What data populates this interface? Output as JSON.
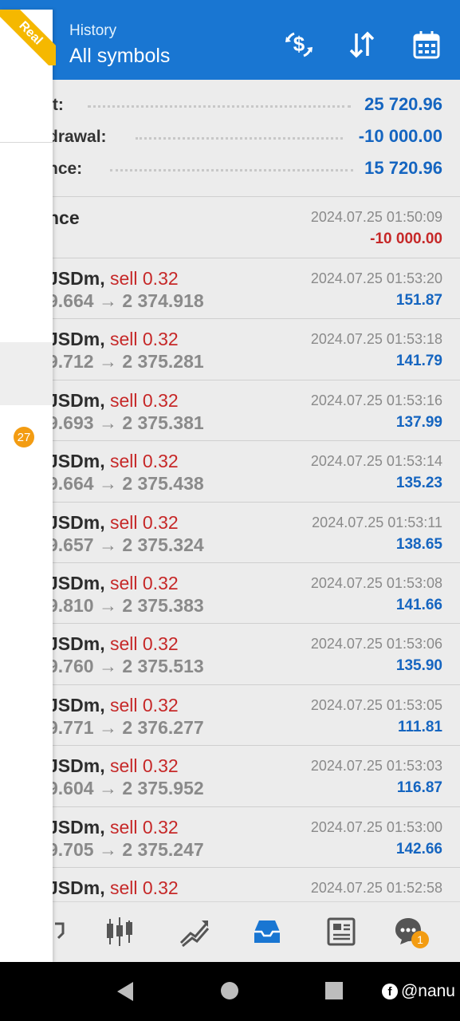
{
  "header": {
    "subtitle": "History",
    "title": "All symbols",
    "icons": [
      "currency-filter-icon",
      "sort-icon",
      "calendar-icon"
    ]
  },
  "account_label": "Real",
  "drawer_badge": "27",
  "summary": [
    {
      "label": "it:",
      "value": "25 720.96"
    },
    {
      "label": "drawal:",
      "value": "-10 000.00"
    },
    {
      "label": "nce:",
      "value": "15 720.96"
    }
  ],
  "balance_row": {
    "title": "nce",
    "time": "2024.07.25 01:50:09",
    "profit": "-10 000.00"
  },
  "trades": [
    {
      "symbol": "JSDm,",
      "side": "sell 0.32",
      "prices": "9.664 → 2 374.918",
      "time": "2024.07.25 01:53:20",
      "profit": "151.87"
    },
    {
      "symbol": "JSDm,",
      "side": "sell 0.32",
      "prices": "9.712 → 2 375.281",
      "time": "2024.07.25 01:53:18",
      "profit": "141.79"
    },
    {
      "symbol": "JSDm,",
      "side": "sell 0.32",
      "prices": "9.693 → 2 375.381",
      "time": "2024.07.25 01:53:16",
      "profit": "137.99"
    },
    {
      "symbol": "JSDm,",
      "side": "sell 0.32",
      "prices": "9.664 → 2 375.438",
      "time": "2024.07.25 01:53:14",
      "profit": "135.23"
    },
    {
      "symbol": "JSDm,",
      "side": "sell 0.32",
      "prices": "9.657 → 2 375.324",
      "time": "2024.07.25 01:53:11",
      "profit": "138.65"
    },
    {
      "symbol": "JSDm,",
      "side": "sell 0.32",
      "prices": "9.810 → 2 375.383",
      "time": "2024.07.25 01:53:08",
      "profit": "141.66"
    },
    {
      "symbol": "JSDm,",
      "side": "sell 0.32",
      "prices": "9.760 → 2 375.513",
      "time": "2024.07.25 01:53:06",
      "profit": "135.90"
    },
    {
      "symbol": "JSDm,",
      "side": "sell 0.32",
      "prices": "9.771 → 2 376.277",
      "time": "2024.07.25 01:53:05",
      "profit": "111.81"
    },
    {
      "symbol": "JSDm,",
      "side": "sell 0.32",
      "prices": "9.604 → 2 375.952",
      "time": "2024.07.25 01:53:03",
      "profit": "116.87"
    },
    {
      "symbol": "JSDm,",
      "side": "sell 0.32",
      "prices": "9.705 → 2 375.247",
      "time": "2024.07.25 01:53:00",
      "profit": "142.66"
    },
    {
      "symbol": "JSDm,",
      "side": "sell 0.32",
      "prices": "",
      "time": "2024.07.25 01:52:58",
      "profit": ""
    }
  ],
  "bottom_nav": {
    "items": [
      "quotes-icon",
      "chart-icon",
      "trade-icon",
      "history-icon",
      "news-icon",
      "chat-icon"
    ],
    "active": "history-icon",
    "chat_badge": "1"
  },
  "watermark": {
    "text": "@nanu",
    "icon": "facebook-icon"
  },
  "colors": {
    "accent": "#1976d2",
    "positive": "#1565c0",
    "negative": "#c62828",
    "badge": "#f39c12"
  }
}
